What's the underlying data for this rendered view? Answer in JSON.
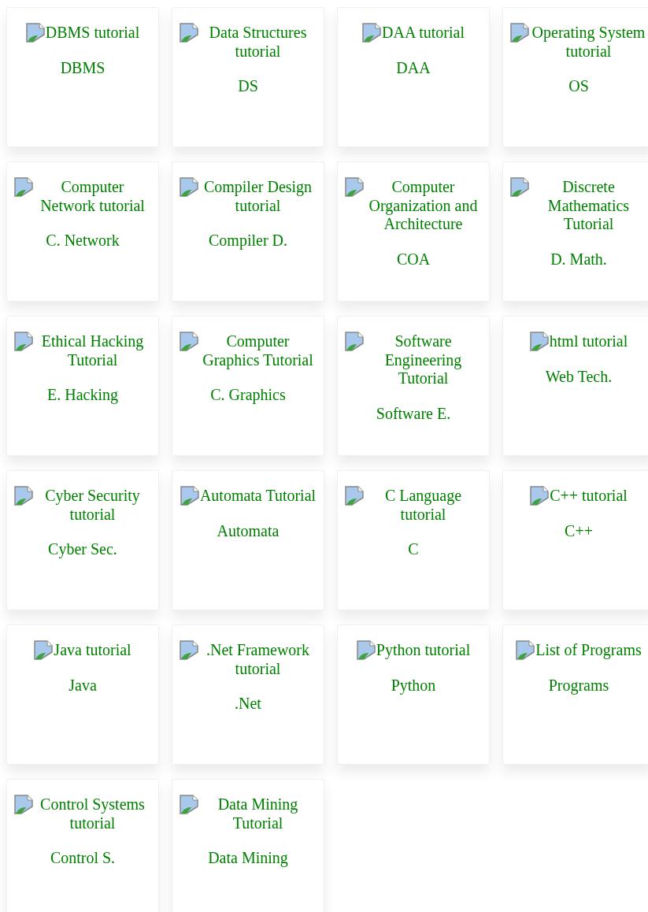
{
  "cards": [
    {
      "alt": "DBMS tutorial",
      "label": "DBMS"
    },
    {
      "alt": "Data Structures tutorial",
      "label": "DS"
    },
    {
      "alt": "DAA tutorial",
      "label": "DAA"
    },
    {
      "alt": "Operating System tutorial",
      "label": "OS"
    },
    {
      "alt": "Computer Network tutorial",
      "label": "C. Network"
    },
    {
      "alt": "Compiler Design tutorial",
      "label": "Compiler D."
    },
    {
      "alt": "Computer Organization and Architecture",
      "label": "COA"
    },
    {
      "alt": "Discrete Mathematics Tutorial",
      "label": "D. Math."
    },
    {
      "alt": "Ethical Hacking Tutorial",
      "label": "E. Hacking"
    },
    {
      "alt": "Computer Graphics Tutorial",
      "label": "C. Graphics"
    },
    {
      "alt": "Software Engineering Tutorial",
      "label": "Software E."
    },
    {
      "alt": "html tutorial",
      "label": "Web Tech."
    },
    {
      "alt": "Cyber Security tutorial",
      "label": "Cyber Sec."
    },
    {
      "alt": "Automata Tutorial",
      "label": "Automata"
    },
    {
      "alt": "C Language tutorial",
      "label": "C"
    },
    {
      "alt": "C++ tutorial",
      "label": "C++"
    },
    {
      "alt": "Java tutorial",
      "label": "Java"
    },
    {
      "alt": ".Net Framework tutorial",
      "label": ".Net"
    },
    {
      "alt": "Python tutorial",
      "label": "Python"
    },
    {
      "alt": "List of Programs",
      "label": "Programs"
    },
    {
      "alt": "Control Systems tutorial",
      "label": "Control S."
    },
    {
      "alt": "Data Mining Tutorial",
      "label": "Data Mining"
    }
  ]
}
